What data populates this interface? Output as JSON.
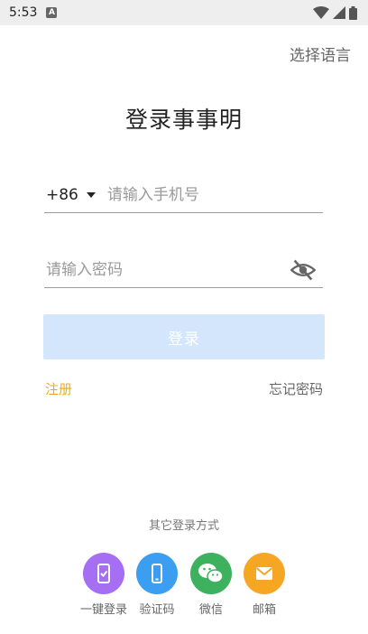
{
  "status_bar": {
    "time": "5:53",
    "notification_badge": "A"
  },
  "header": {
    "language_link": "选择语言"
  },
  "app": {
    "title": "登录事事明"
  },
  "phone": {
    "country_code": "+86",
    "placeholder": "请输入手机号",
    "value": ""
  },
  "password": {
    "placeholder": "请输入密码",
    "value": ""
  },
  "login_button": {
    "label": "登录"
  },
  "links": {
    "register": "注册",
    "forgot_password": "忘记密码"
  },
  "other_login": {
    "title": "其它登录方式",
    "options": [
      {
        "label": "一键登录",
        "icon": "phone-check-icon",
        "color": "#a66ef2"
      },
      {
        "label": "验证码",
        "icon": "smartphone-icon",
        "color": "#3b9ef0"
      },
      {
        "label": "微信",
        "icon": "wechat-icon",
        "color": "#3db15e"
      },
      {
        "label": "邮箱",
        "icon": "mail-icon",
        "color": "#f5a623"
      }
    ]
  },
  "colors": {
    "accent_orange": "#f2a81b",
    "button_disabled": "#d3e6fb"
  }
}
